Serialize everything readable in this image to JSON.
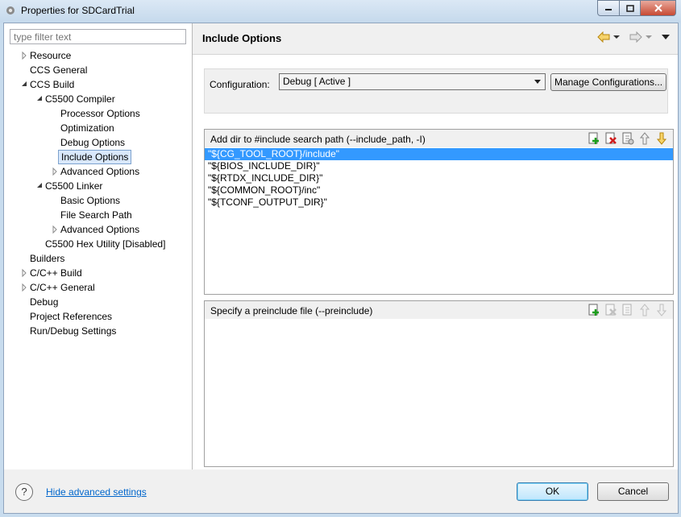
{
  "window": {
    "title": "Properties for SDCardTrial"
  },
  "filter": {
    "placeholder": "type filter text"
  },
  "tree": [
    {
      "label": "Resource",
      "toggle": "collapsed"
    },
    {
      "label": "CCS General",
      "toggle": "none"
    },
    {
      "label": "CCS Build",
      "toggle": "expanded"
    },
    {
      "label": "C5500 Compiler",
      "toggle": "expanded"
    },
    {
      "label": "Processor Options",
      "toggle": "none"
    },
    {
      "label": "Optimization",
      "toggle": "none"
    },
    {
      "label": "Debug Options",
      "toggle": "none"
    },
    {
      "label": "Include Options",
      "toggle": "none",
      "selected": true
    },
    {
      "label": "Advanced Options",
      "toggle": "collapsed"
    },
    {
      "label": "C5500 Linker",
      "toggle": "expanded"
    },
    {
      "label": "Basic Options",
      "toggle": "none"
    },
    {
      "label": "File Search Path",
      "toggle": "none"
    },
    {
      "label": "Advanced Options",
      "toggle": "collapsed"
    },
    {
      "label": "C5500 Hex Utility  [Disabled]",
      "toggle": "none"
    },
    {
      "label": "Builders",
      "toggle": "none"
    },
    {
      "label": "C/C++ Build",
      "toggle": "collapsed"
    },
    {
      "label": "C/C++ General",
      "toggle": "collapsed"
    },
    {
      "label": "Debug",
      "toggle": "none"
    },
    {
      "label": "Project References",
      "toggle": "none"
    },
    {
      "label": "Run/Debug Settings",
      "toggle": "none"
    }
  ],
  "page": {
    "title": "Include Options",
    "configuration_label": "Configuration:",
    "configuration_value": "Debug  [ Active ]",
    "manage_button": "Manage Configurations..."
  },
  "include_panel": {
    "title": "Add dir to #include search path (--include_path, -I)",
    "items": [
      "\"${CG_TOOL_ROOT}/include\"",
      "\"${BIOS_INCLUDE_DIR}\"",
      "\"${RTDX_INCLUDE_DIR}\"",
      "\"${COMMON_ROOT}/inc\"",
      "\"${TCONF_OUTPUT_DIR}\""
    ],
    "selected_index": 0
  },
  "preinclude_panel": {
    "title": "Specify a preinclude file (--preinclude)",
    "items": []
  },
  "footer": {
    "help_symbol": "?",
    "hide_advanced": "Hide advanced settings",
    "ok": "OK",
    "cancel": "Cancel"
  }
}
